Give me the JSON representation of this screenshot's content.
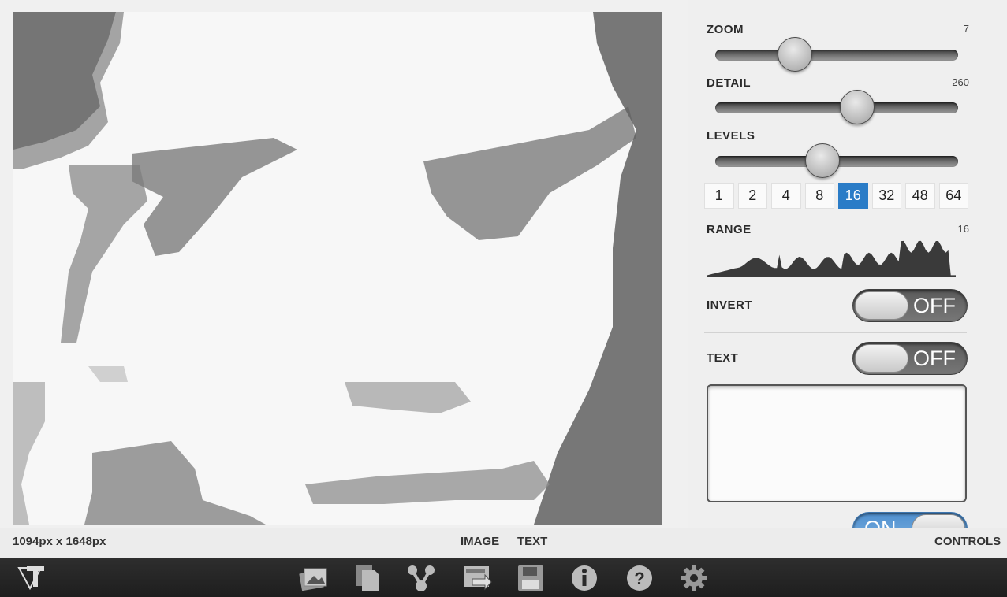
{
  "panel": {
    "zoom": {
      "label": "ZOOM",
      "value": "7",
      "level": 0.3
    },
    "detail": {
      "label": "DETAIL",
      "value": "260",
      "level": 0.6
    },
    "levels": {
      "label": "LEVELS",
      "level": 0.43,
      "options": [
        "1",
        "2",
        "4",
        "8",
        "16",
        "32",
        "48",
        "64"
      ],
      "selected": "16"
    },
    "range": {
      "label": "RANGE",
      "value": "16"
    },
    "invert": {
      "label": "INVERT",
      "state": "OFF"
    },
    "text": {
      "label": "TEXT",
      "state": "OFF"
    },
    "repeat": {
      "state": "ON"
    }
  },
  "status": {
    "dimensions": "1094px x 1648px",
    "tab_image": "IMAGE",
    "tab_text": "TEXT",
    "controls": "CONTROLS"
  },
  "toolbar": {
    "icons": [
      "app-logo-icon",
      "images-icon",
      "copy-icon",
      "share-icon",
      "export-icon",
      "save-icon",
      "info-icon",
      "help-icon",
      "settings-icon"
    ]
  },
  "colors": {
    "accent": "#2a7cc7",
    "toolbar": "#262626"
  }
}
